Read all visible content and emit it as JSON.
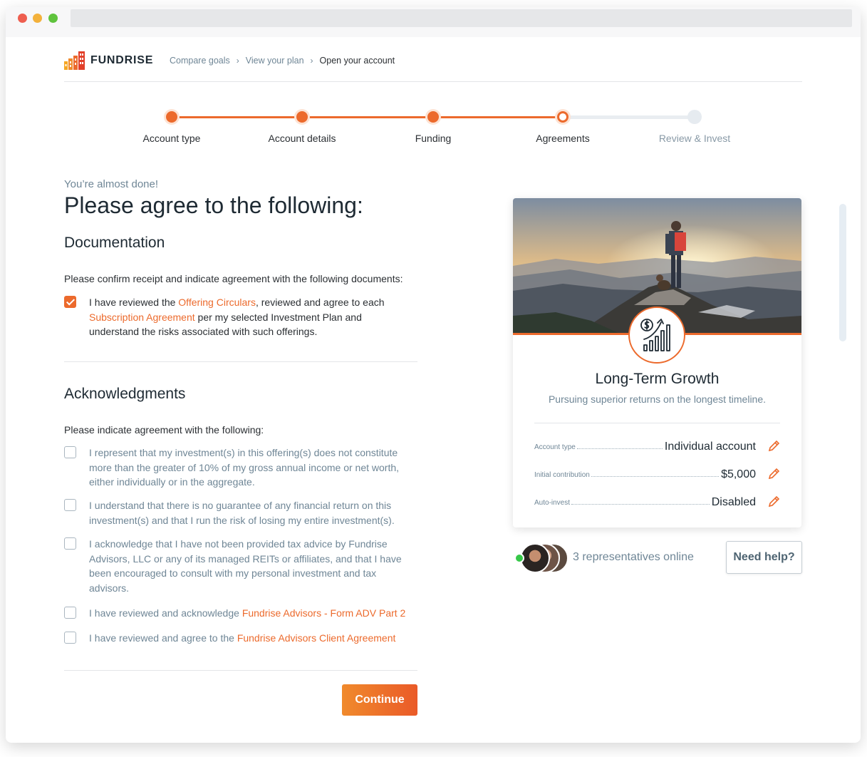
{
  "brand": {
    "name": "FUNDRISE",
    "accent": "#ec6a2c"
  },
  "breadcrumb": [
    "Compare goals",
    "View your plan",
    "Open your account"
  ],
  "steps": [
    {
      "label": "Account type",
      "state": "done"
    },
    {
      "label": "Account details",
      "state": "done"
    },
    {
      "label": "Funding",
      "state": "done"
    },
    {
      "label": "Agreements",
      "state": "current"
    },
    {
      "label": "Review & Invest",
      "state": "todo"
    }
  ],
  "page": {
    "eyebrow": "You’re almost done!",
    "title": "Please agree to the following:"
  },
  "documentation": {
    "heading": "Documentation",
    "intro": "Please confirm receipt and indicate agreement with the following documents:",
    "item": {
      "checked": true,
      "text_a": "I have reviewed the ",
      "link_a": "Offering Circulars",
      "text_b": ", reviewed and agree to each ",
      "link_b": "Subscription Agreement",
      "text_c": " per my selected Investment Plan and understand the risks associated with such offerings."
    }
  },
  "acknowledgments": {
    "heading": "Acknowledgments",
    "intro": "Please indicate agreement with the following:",
    "item1": "I represent that my investment(s) in this offering(s) does not constitute more than the greater of 10% of my gross annual income or net worth, either individually or in the aggregate.",
    "item2": "I understand that there is no guarantee of any financial return on this investment(s) and that I run the risk of losing my entire investment(s).",
    "item3": "I acknowledge that I have not been provided tax advice by Fundrise Advisors, LLC or any of its managed REITs or affiliates, and that I have been encouraged to consult with my personal investment and tax advisors.",
    "item4_text": "I have reviewed and acknowledge ",
    "item4_link": "Fundrise Advisors - Form ADV Part 2",
    "item5_text": "I have reviewed and agree to the ",
    "item5_link": "Fundrise Advisors Client Agreement"
  },
  "continue_label": "Continue",
  "plan": {
    "title": "Long-Term Growth",
    "subtitle": "Pursuing superior returns on the longest timeline.",
    "details": [
      {
        "label": "Account type",
        "value": "Individual account"
      },
      {
        "label": "Initial contribution",
        "value": "$5,000"
      },
      {
        "label": "Auto-invest",
        "value": "Disabled"
      }
    ]
  },
  "help": {
    "reps": "3 representatives online",
    "button": "Need help?"
  }
}
